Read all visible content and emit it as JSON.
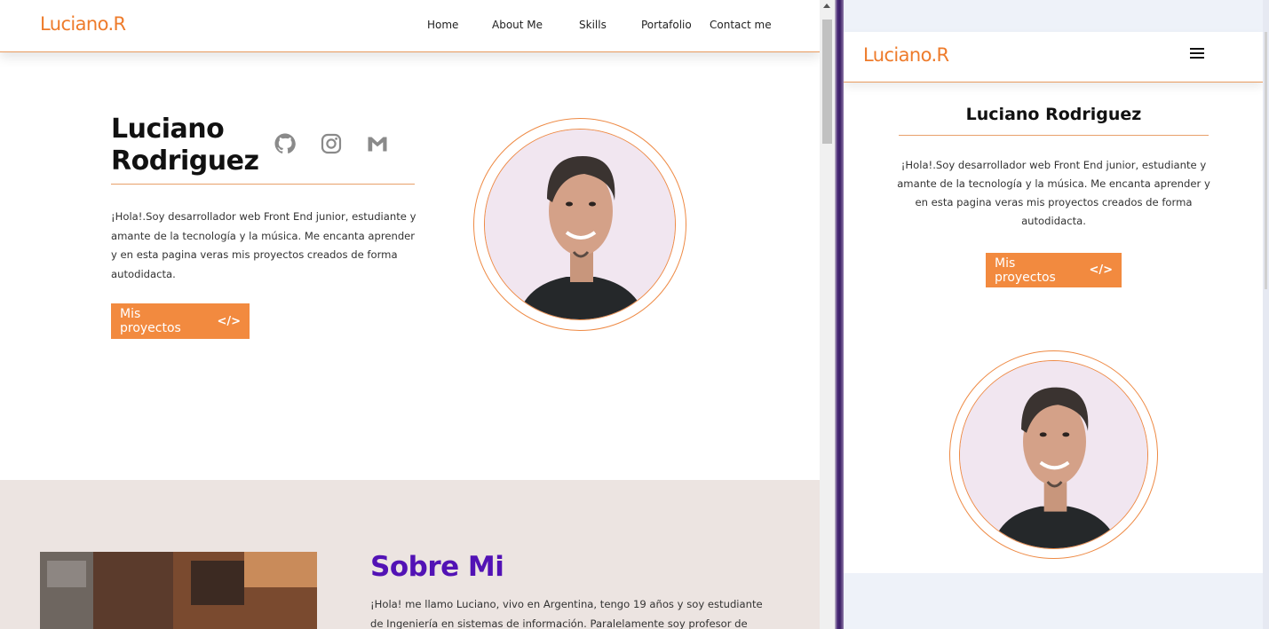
{
  "desktop": {
    "logo": "Luciano.R",
    "nav": [
      "Home",
      "About Me",
      "Skills",
      "Portafolio",
      "Contact me"
    ],
    "hero": {
      "name_line1": "Luciano",
      "name_line2": "Rodriguez",
      "description": "¡Hola!.Soy desarrollador web Front End junior, estudiante y amante de la tecnología y la música. Me encanta aprender y en esta pagina veras mis proyectos creados de forma autodidacta.",
      "button_label": "Mis proyectos",
      "button_icon": "</>"
    },
    "social_icons": [
      "github-icon",
      "instagram-icon",
      "gmail-icon"
    ],
    "about": {
      "title": "Sobre Mi",
      "text": "¡Hola! me llamo Luciano, vivo en Argentina, tengo 19 años y soy estudiante de Ingeniería en sistemas de información. Paralelamente soy profesor de"
    }
  },
  "mobile": {
    "logo": "Luciano.R",
    "name": "Luciano Rodriguez",
    "description": "¡Hola!.Soy desarrollador web Front End junior, estudiante y amante de la tecnología y la música. Me encanta aprender y en esta pagina veras mis proyectos creados de forma autodidacta.",
    "button_label": "Mis proyectos",
    "button_icon": "</>",
    "menu_icon": "hamburger-icon"
  },
  "colors": {
    "accent": "#f28a3f",
    "logo": "#ee7b2b",
    "about_title": "#5212b5",
    "about_bg": "#ece4e1"
  }
}
